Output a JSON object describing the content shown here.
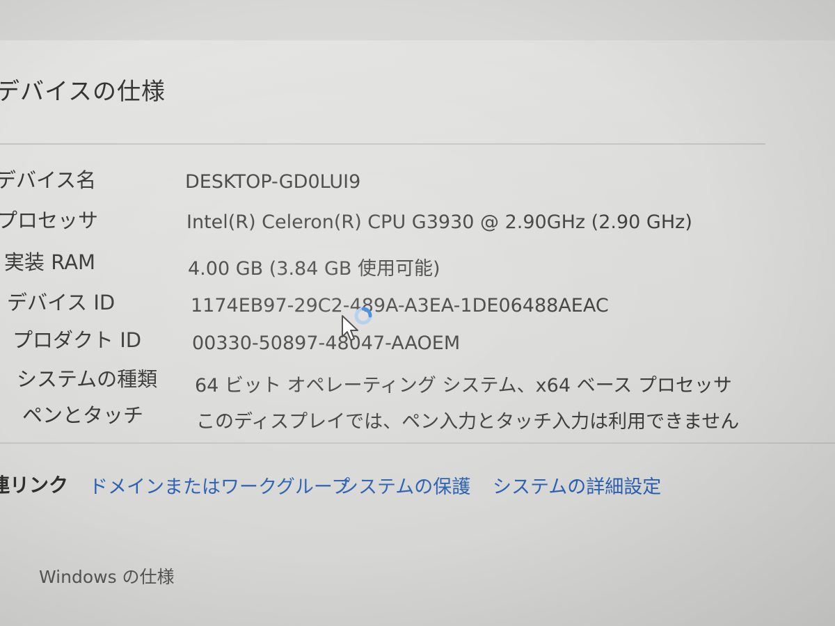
{
  "section_title": "デバイスの仕様",
  "specs": [
    {
      "label": "デバイス名",
      "value": "DESKTOP-GD0LUI9"
    },
    {
      "label": "プロセッサ",
      "value": "Intel(R) Celeron(R) CPU G3930 @ 2.90GHz (2.90 GHz)"
    },
    {
      "label": "実装 RAM",
      "value": "4.00 GB (3.84 GB 使用可能)"
    },
    {
      "label": "デバイス ID",
      "value": "1174EB97-29C2-489A-A3EA-1DE06488AEAC"
    },
    {
      "label": "プロダクト ID",
      "value": "00330-50897-48047-AAOEM"
    },
    {
      "label": "システムの種類",
      "value": "64 ビット オペレーティング システム、x64 ベース プロセッサ"
    },
    {
      "label": "ペンとタッチ",
      "value": "このディスプレイでは、ペン入力とタッチ入力は利用できません"
    }
  ],
  "related_links": {
    "label": "連リンク",
    "links": [
      "ドメインまたはワークグループ",
      "システムの保護",
      "システムの詳細設定"
    ]
  },
  "windows_section": {
    "title": "Windows の仕様",
    "icon": "windows-logo-icon"
  },
  "colors": {
    "background": "#dcdcda",
    "link": "#2a5fb0",
    "busy_ring": "#2f7fd6"
  },
  "pointer": {
    "icon": "busy-cursor-icon"
  }
}
